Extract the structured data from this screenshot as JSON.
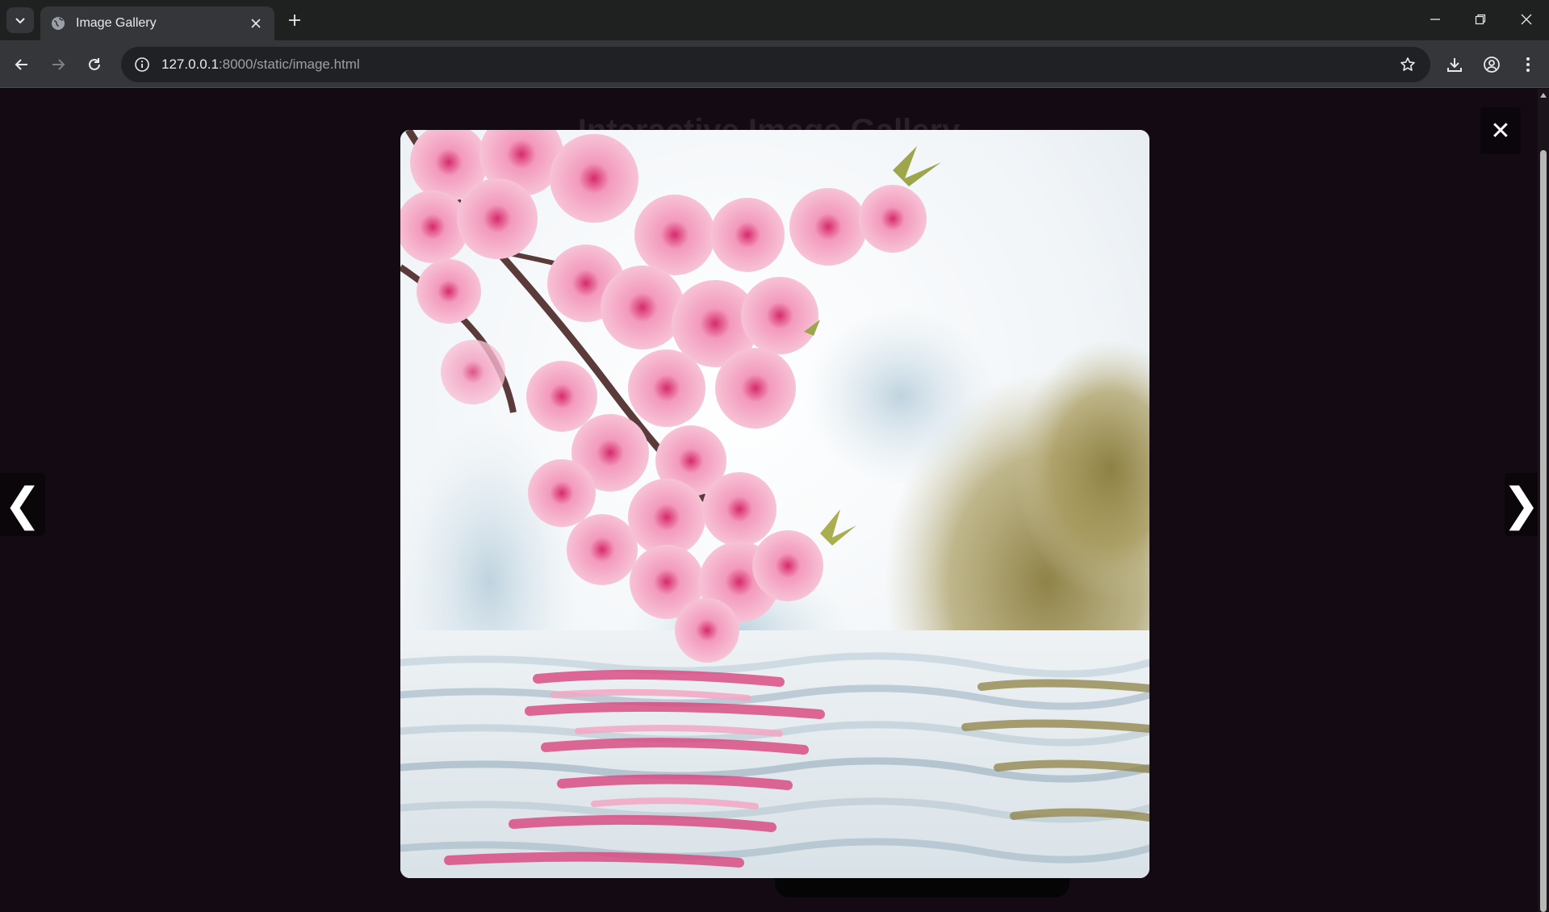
{
  "browser": {
    "tab_title": "Image Gallery",
    "url_host": "127.0.0.1",
    "url_rest": ":8000/static/image.html"
  },
  "page": {
    "heading": "Interactive Image Gallery"
  },
  "lightbox": {
    "close_label": "✕",
    "prev_label": "❮",
    "next_label": "❯",
    "image_subject": "pink cherry blossom branch reflected in water"
  },
  "icons": {
    "tab_search": "chevron-down-icon",
    "favicon": "globe-icon",
    "tab_close": "close-icon",
    "new_tab": "plus-icon",
    "back": "arrow-left-icon",
    "forward": "arrow-right-icon",
    "reload": "reload-icon",
    "site_info": "info-icon",
    "bookmark": "star-icon",
    "downloads": "download-icon",
    "profile": "profile-icon",
    "menu": "kebab-menu-icon"
  },
  "colors": {
    "page_background": "#140a14",
    "chrome_dark": "#1f2020",
    "chrome_toolbar": "#35363a"
  }
}
